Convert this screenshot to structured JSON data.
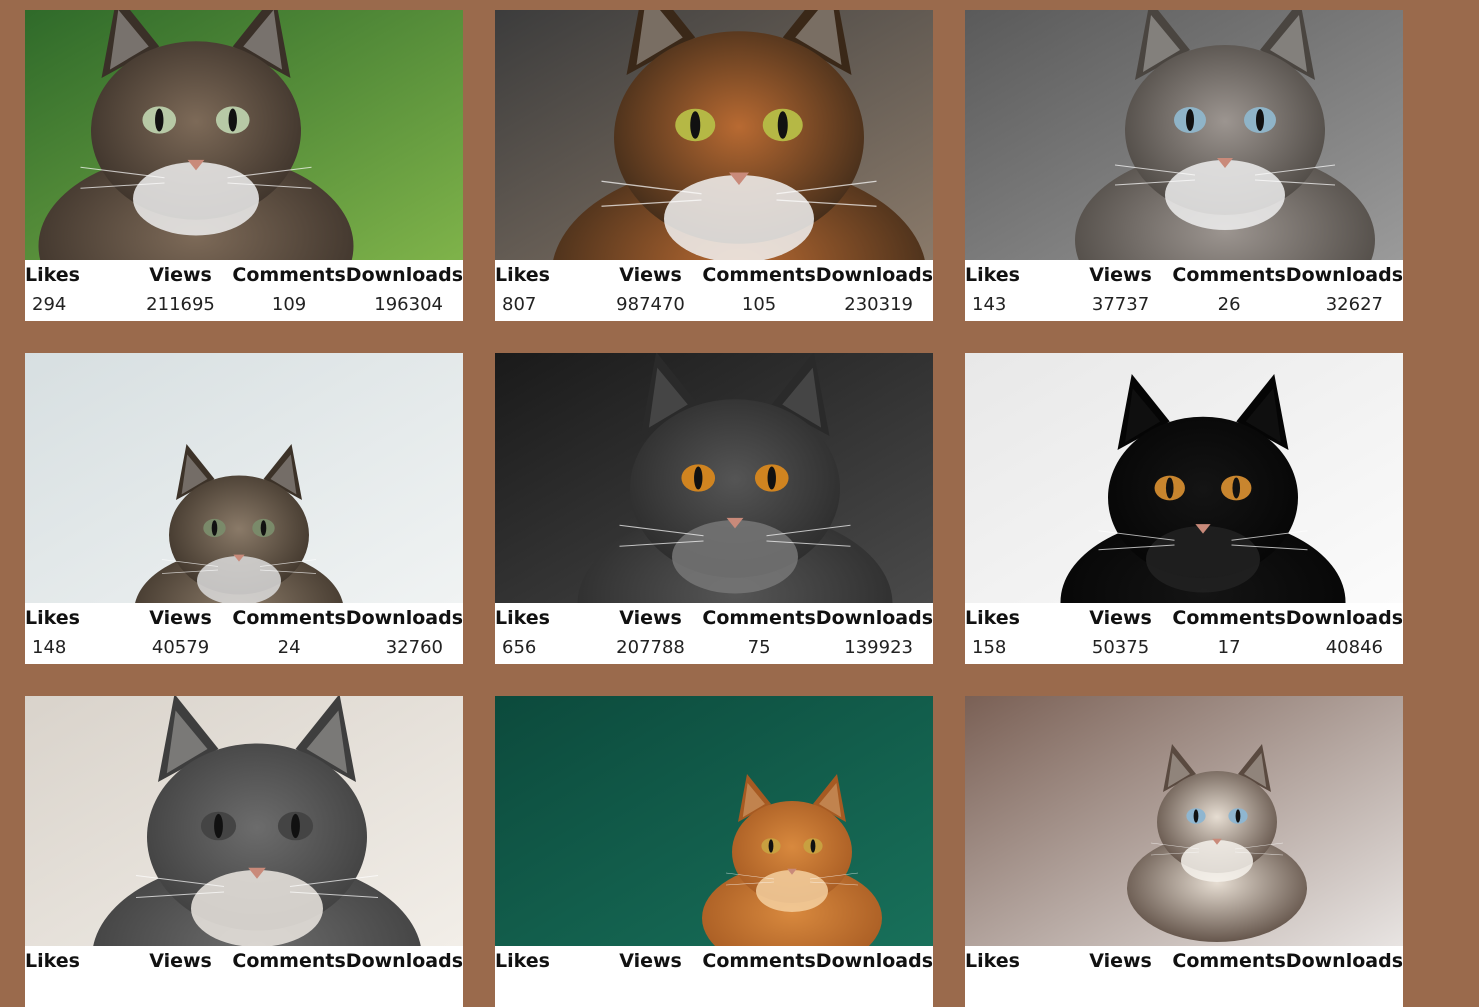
{
  "labels": {
    "likes": "Likes",
    "views": "Views",
    "comments": "Comments",
    "downloads": "Downloads"
  },
  "cards": [
    {
      "photo": "tabby-cat-green-background",
      "likes": "294",
      "views": "211695",
      "comments": "109",
      "downloads": "196304",
      "colors": {
        "bg1": "#2f6a2a",
        "bg2": "#7fb34a",
        "fur": "#7d6a58",
        "fur2": "#3a3028",
        "white": "#eeeeee",
        "eye": "#b7c9a6"
      }
    },
    {
      "photo": "orange-tabby-closeup",
      "likes": "807",
      "views": "987470",
      "comments": "105",
      "downloads": "230319",
      "colors": {
        "bg1": "#3c3c3c",
        "bg2": "#8a7a6a",
        "fur": "#b86a32",
        "fur2": "#3a2818",
        "white": "#f2f2f2",
        "eye": "#b5b845"
      }
    },
    {
      "photo": "grey-tabby-wicker-background",
      "likes": "143",
      "views": "37737",
      "comments": "26",
      "downloads": "32627",
      "colors": {
        "bg1": "#5a5a5a",
        "bg2": "#9a9a9a",
        "fur": "#9c9590",
        "fur2": "#4a4540",
        "white": "#eeeeee",
        "eye": "#8fb4c8"
      }
    },
    {
      "photo": "tabby-lying-on-stool",
      "likes": "148",
      "views": "40579",
      "comments": "24",
      "downloads": "32760",
      "colors": {
        "bg1": "#d7dfe1",
        "bg2": "#f0f3f3",
        "fur": "#8a7a68",
        "fur2": "#3c3228",
        "white": "#dcdcdc",
        "eye": "#7a8a6a"
      }
    },
    {
      "photo": "grey-british-shorthair",
      "likes": "656",
      "views": "207788",
      "comments": "75",
      "downloads": "139923",
      "colors": {
        "bg1": "#1a1a1a",
        "bg2": "#4a4a4a",
        "fur": "#555555",
        "fur2": "#2a2a2a",
        "white": "#777777",
        "eye": "#d08420"
      }
    },
    {
      "photo": "black-cat-white-background",
      "likes": "158",
      "views": "50375",
      "comments": "17",
      "downloads": "40846",
      "colors": {
        "bg1": "#e8e8e8",
        "bg2": "#fbfbfb",
        "fur": "#141414",
        "fur2": "#050505",
        "white": "#222222",
        "eye": "#c8852e"
      }
    },
    {
      "photo": "grey-cat-sleeping",
      "likes": "",
      "views": "",
      "comments": "",
      "downloads": "",
      "colors": {
        "bg1": "#d9d3cb",
        "bg2": "#f2eee8",
        "fur": "#6c6c6c",
        "fur2": "#3e3e3e",
        "white": "#ece8e2",
        "eye": "#444444"
      }
    },
    {
      "photo": "orange-kitten-green-door",
      "likes": "",
      "views": "",
      "comments": "",
      "downloads": "",
      "colors": {
        "bg1": "#0c4a3c",
        "bg2": "#18705a",
        "fur": "#d8893e",
        "fur2": "#a65a22",
        "white": "#f4d0a0",
        "eye": "#c8a040"
      }
    },
    {
      "photo": "siamese-cat",
      "likes": "",
      "views": "",
      "comments": "",
      "downloads": "",
      "colors": {
        "bg1": "#7a6055",
        "bg2": "#e8e4e2",
        "fur": "#e6ddd2",
        "fur2": "#5a4a40",
        "white": "#f6f2ec",
        "eye": "#8fb6d0"
      }
    }
  ]
}
